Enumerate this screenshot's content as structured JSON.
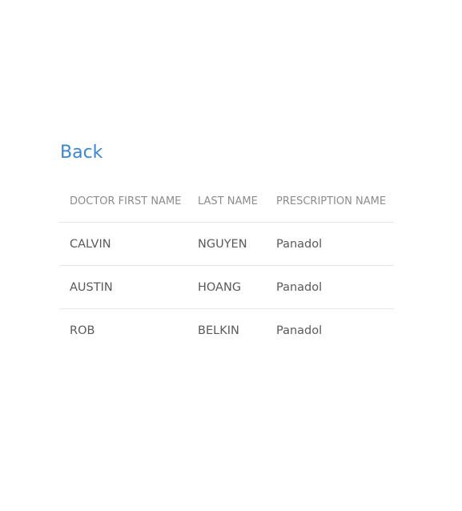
{
  "nav": {
    "back_label": "Back"
  },
  "table": {
    "headers": [
      "DOCTOR FIRST NAME",
      "LAST NAME",
      "PRESCRIPTION NAME"
    ],
    "rows": [
      [
        "CALVIN",
        "NGUYEN",
        "Panadol"
      ],
      [
        "AUSTIN",
        "HOANG",
        "Panadol"
      ],
      [
        "ROB",
        "BELKIN",
        "Panadol"
      ]
    ]
  },
  "colors": {
    "link": "#3a86d6",
    "header_text": "#8c8c8c",
    "cell_text": "#5a5a5a",
    "divider": "#e6e6e6"
  }
}
